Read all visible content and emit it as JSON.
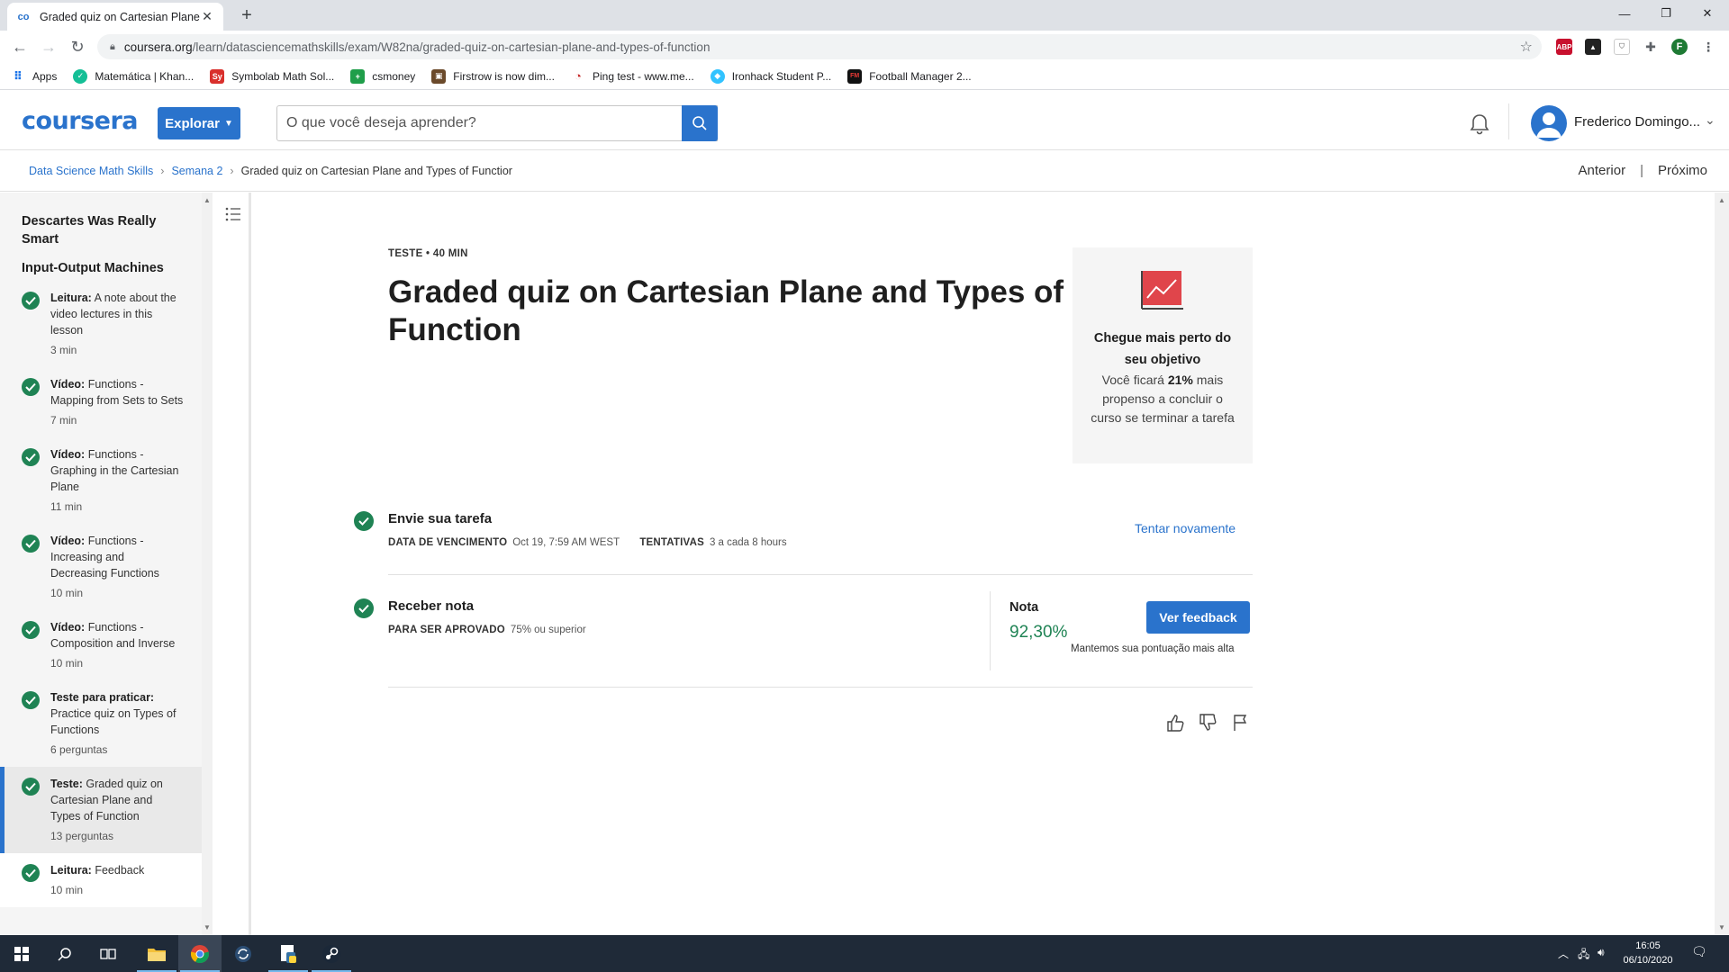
{
  "browser": {
    "tab_title": "Graded quiz on Cartesian Plane a",
    "url_host": "coursera.org",
    "url_path": "/learn/datasciencemathskills/exam/W82na/graded-quiz-on-cartesian-plane-and-types-of-function",
    "profile_initial": "F",
    "ext_abp": "ABP",
    "bookmarks": [
      {
        "label": "Apps",
        "icon": "apps-grid-icon"
      },
      {
        "label": "Matemática | Khan...",
        "icon": "khan-academy-icon"
      },
      {
        "label": "Symbolab Math Sol...",
        "icon": "symbolab-icon",
        "badge": "Sy"
      },
      {
        "label": "csmoney",
        "icon": "csmoney-icon"
      },
      {
        "label": "Firstrow is now dim...",
        "icon": "firstrow-icon"
      },
      {
        "label": "Ping test - www.me...",
        "icon": "ping-test-icon"
      },
      {
        "label": "Ironhack Student P...",
        "icon": "ironhack-icon"
      },
      {
        "label": "Football Manager 2...",
        "icon": "football-manager-icon",
        "badge": "FM"
      }
    ]
  },
  "header": {
    "logo": "coursera",
    "explore_label": "Explorar",
    "search_placeholder": "O que você deseja aprender?",
    "user_name": "Frederico Domingo..."
  },
  "breadcrumb": {
    "course": "Data Science Math Skills",
    "week": "Semana 2",
    "current": "Graded quiz on Cartesian Plane and Types of Functior",
    "prev": "Anterior",
    "next": "Próximo"
  },
  "sidebar": {
    "lesson_title": "Descartes Was Really Smart",
    "section_title": "Input-Output Machines",
    "items": [
      {
        "kind": "Leitura:",
        "title": "A note about the video lectures in this lesson",
        "meta": "3 min",
        "completed": true
      },
      {
        "kind": "Vídeo:",
        "title": "Functions - Mapping from Sets to Sets",
        "meta": "7 min",
        "completed": true
      },
      {
        "kind": "Vídeo:",
        "title": "Functions - Graphing in the Cartesian Plane",
        "meta": "11 min",
        "completed": true
      },
      {
        "kind": "Vídeo:",
        "title": "Functions - Increasing and Decreasing Functions",
        "meta": "10 min",
        "completed": true
      },
      {
        "kind": "Vídeo:",
        "title": "Functions - Composition and Inverse",
        "meta": "10 min",
        "completed": true
      },
      {
        "kind": "Teste para praticar:",
        "title": "Practice quiz on Types of Functions",
        "meta": "6 perguntas",
        "completed": true
      },
      {
        "kind": "Teste:",
        "title": "Graded quiz on Cartesian Plane and Types of Function",
        "meta": "13 perguntas",
        "completed": true,
        "active": true
      },
      {
        "kind": "Leitura:",
        "title": "Feedback",
        "meta": "10 min",
        "completed": true
      }
    ]
  },
  "quiz": {
    "eyebrow": "TESTE • 40 MIN",
    "title": "Graded quiz on Cartesian Plane and Types of Function",
    "goal": {
      "heading": "Chegue mais perto do seu objetivo",
      "body_pre": "Você ficará ",
      "body_pct": "21%",
      "body_post": " mais propenso a concluir o curso se terminar a tarefa"
    },
    "submit": {
      "heading": "Envie sua tarefa",
      "due_label": "DATA DE VENCIMENTO",
      "due_value": "Oct 19, 7:59 AM WEST",
      "attempts_label": "TENTATIVAS",
      "attempts_value": "3 a cada 8 hours",
      "retry_label": "Tentar novamente"
    },
    "grade": {
      "heading": "Receber nota",
      "pass_label": "PARA SER APROVADO",
      "pass_value": "75% ou superior",
      "nota_label": "Nota",
      "nota_value": "92,30%",
      "feedback_label": "Ver feedback",
      "note": "Mantemos sua pontuação mais alta"
    }
  },
  "taskbar": {
    "time": "16:05",
    "date": "06/10/2020"
  },
  "colors": {
    "brand_blue": "#2a73cc",
    "success_green": "#1f8354",
    "chart_red": "#e0454b"
  }
}
